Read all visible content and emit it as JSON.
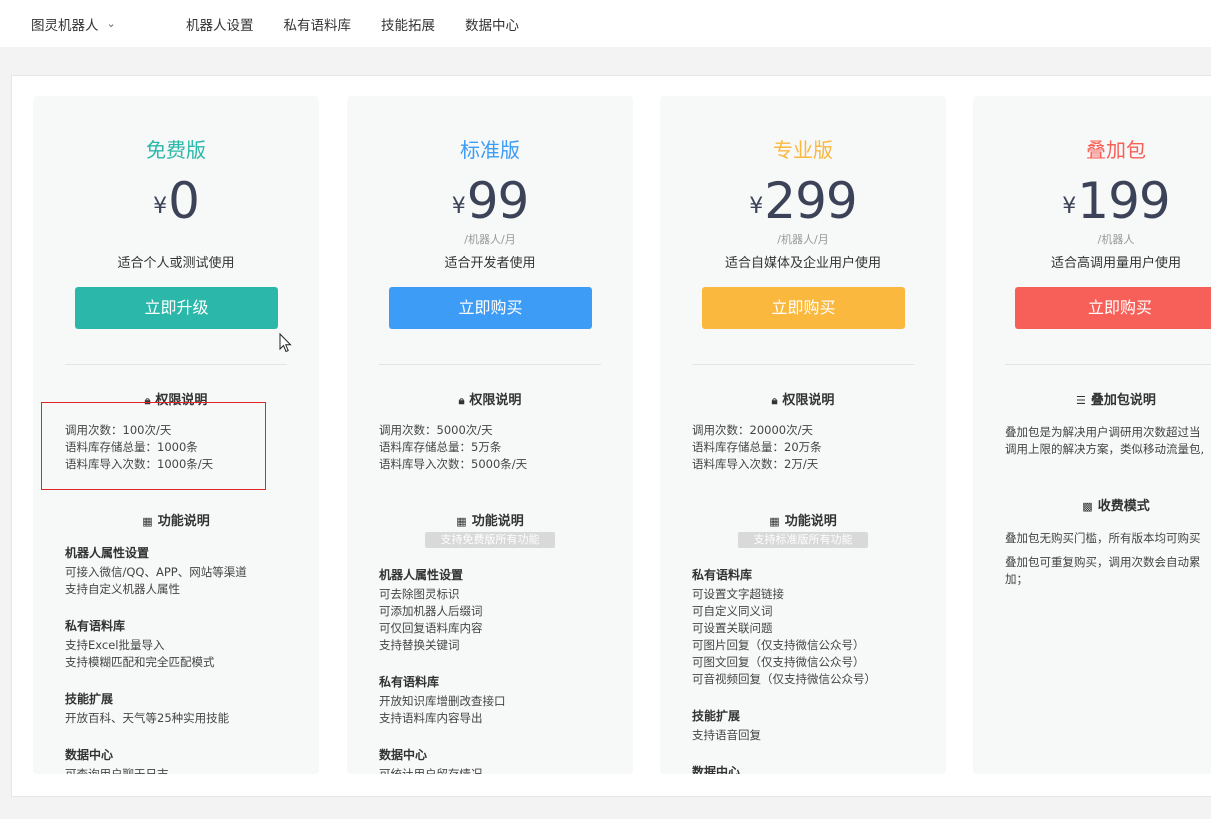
{
  "topbar": {
    "brand": "图灵机器人",
    "nav": [
      "机器人设置",
      "私有语料库",
      "技能拓展",
      "数据中心"
    ]
  },
  "colors": {
    "free": "#2bb8aa",
    "standard": "#3d9cf5",
    "pro": "#fbb83e",
    "addon": "#f76058"
  },
  "cards": {
    "free": {
      "title": "免费版",
      "currency": "¥",
      "price": "0",
      "desc": "适合个人或测试使用",
      "button": "立即升级",
      "perm_title": "权限说明",
      "perms": [
        "调用次数：100次/天",
        "语料库存储总量：1000条",
        "语料库导入次数：1000条/天"
      ],
      "func_title": "功能说明",
      "groups": [
        {
          "head": "机器人属性设置",
          "items": [
            "可接入微信/QQ、APP、网站等渠道",
            "支持自定义机器人属性"
          ]
        },
        {
          "head": "私有语料库",
          "items": [
            "支持Excel批量导入",
            "支持模糊匹配和完全匹配模式"
          ]
        },
        {
          "head": "技能扩展",
          "items": [
            "开放百科、天气等25种实用技能"
          ]
        },
        {
          "head": "数据中心",
          "items": [
            "可查询用户聊天日志"
          ]
        }
      ]
    },
    "standard": {
      "title": "标准版",
      "currency": "¥",
      "price": "99",
      "unit": "/机器人/月",
      "desc": "适合开发者使用",
      "button": "立即购买",
      "perm_title": "权限说明",
      "perms": [
        "调用次数：5000次/天",
        "语料库存储总量：5万条",
        "语料库导入次数：5000条/天"
      ],
      "func_title": "功能说明",
      "badge": "支持免费版所有功能",
      "groups": [
        {
          "head": "机器人属性设置",
          "items": [
            "可去除图灵标识",
            "可添加机器人后缀词",
            "可仅回复语料库内容",
            "支持替换关键词"
          ]
        },
        {
          "head": "私有语料库",
          "items": [
            "开放知识库增删改查接口",
            "支持语料库内容导出"
          ]
        },
        {
          "head": "数据中心",
          "items": [
            "可统计用户留存情况"
          ]
        }
      ]
    },
    "pro": {
      "title": "专业版",
      "currency": "¥",
      "price": "299",
      "unit": "/机器人/月",
      "desc": "适合自媒体及企业用户使用",
      "button": "立即购买",
      "perm_title": "权限说明",
      "perms": [
        "调用次数：20000次/天",
        "语料库存储总量：20万条",
        "语料库导入次数：2万/天"
      ],
      "func_title": "功能说明",
      "badge": "支持标准版所有功能",
      "groups": [
        {
          "head": "私有语料库",
          "items": [
            "可设置文字超链接",
            "可自定义同义词",
            "可设置关联问题",
            "可图片回复（仅支持微信公众号）",
            "可图文回复（仅支持微信公众号）",
            "可音视频回复（仅支持微信公众号）"
          ]
        },
        {
          "head": "技能扩展",
          "items": [
            "支持语音回复"
          ]
        },
        {
          "head": "数据中心",
          "items": []
        }
      ]
    },
    "addon": {
      "title": "叠加包",
      "currency": "¥",
      "price": "199",
      "unit": "/机器人",
      "desc": "适合高调用量用户使用",
      "button": "立即购买",
      "info_title": "叠加包说明",
      "info": [
        "叠加包是为解决用户调研用次数超过当",
        "调用上限的解决方案，类似移动流量包,"
      ],
      "fee_title": "收费模式",
      "fee1": "叠加包无购买门槛，所有版本均可购买",
      "fee2": [
        "叠加包可重复购买，调用次数会自动累",
        "加；"
      ]
    }
  }
}
